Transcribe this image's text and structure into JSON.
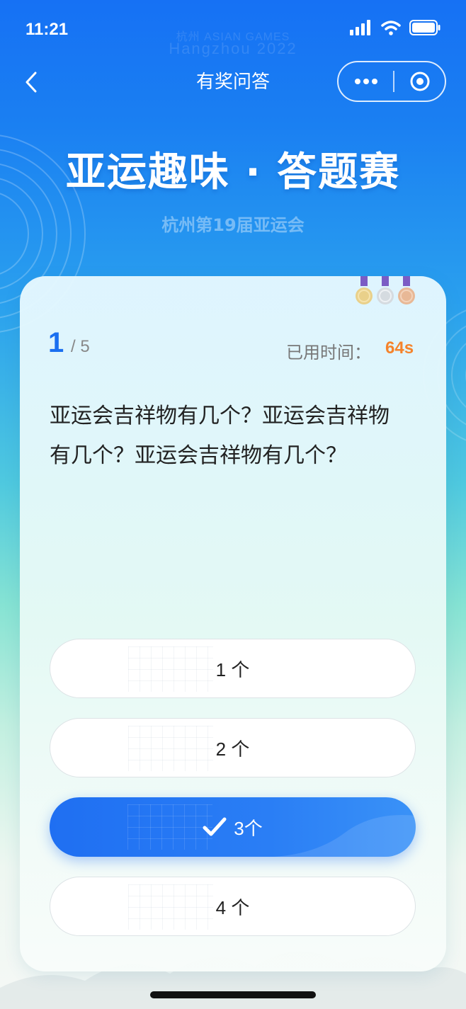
{
  "status_bar": {
    "time": "11:21",
    "icons": [
      "signal-icon",
      "wifi-icon",
      "battery-icon"
    ]
  },
  "watermark": {
    "line1": "杭州 ASIAN GAMES",
    "line2": "Hangzhou 2022"
  },
  "nav": {
    "title": "有奖问答",
    "back_icon": "chevron-left-icon",
    "more_icon": "more-dots-icon",
    "close_icon": "target-close-icon"
  },
  "hero": {
    "title": "亚运趣味 · 答题赛",
    "subtitle": "杭州第19届亚运会"
  },
  "quiz": {
    "current": "1",
    "total": "/ 5",
    "timer_label": "已用时间：",
    "timer_value": "64s",
    "question": "亚运会吉祥物有几个？亚运会吉祥物有几个？亚运会吉祥物有几个？",
    "options": [
      {
        "label": "1 个",
        "selected": false
      },
      {
        "label": "2 个",
        "selected": false
      },
      {
        "label": "3个",
        "selected": true
      },
      {
        "label": "4 个",
        "selected": false
      }
    ]
  },
  "colors": {
    "primary": "#1a6ff0",
    "timer": "#f5832b",
    "text": "#222222"
  }
}
